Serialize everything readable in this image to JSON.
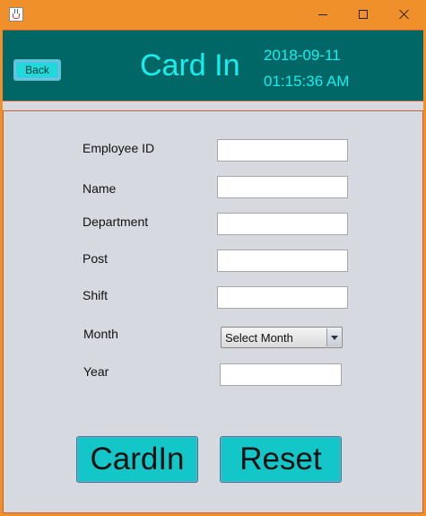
{
  "window": {
    "icon": "java-cup-icon"
  },
  "titlebar": {
    "minimize_icon": "minimize-icon",
    "maximize_icon": "maximize-icon",
    "close_icon": "close-icon"
  },
  "header": {
    "back_label": "Back",
    "title": "Card In",
    "date": "2018-09-11",
    "time": "01:15:36 AM",
    "background_color": "#006666",
    "accent_color": "#13f0ee"
  },
  "form": {
    "employee_id": {
      "label": "Employee ID",
      "value": ""
    },
    "name": {
      "label": "Name",
      "value": ""
    },
    "department": {
      "label": "Department",
      "value": ""
    },
    "post": {
      "label": "Post",
      "value": ""
    },
    "shift": {
      "label": "Shift",
      "value": ""
    },
    "month": {
      "label": "Month",
      "selected": "Select Month"
    },
    "year": {
      "label": "Year",
      "value": ""
    }
  },
  "actions": {
    "cardin_label": "CardIn",
    "reset_label": "Reset",
    "button_color": "#13c7c9"
  }
}
